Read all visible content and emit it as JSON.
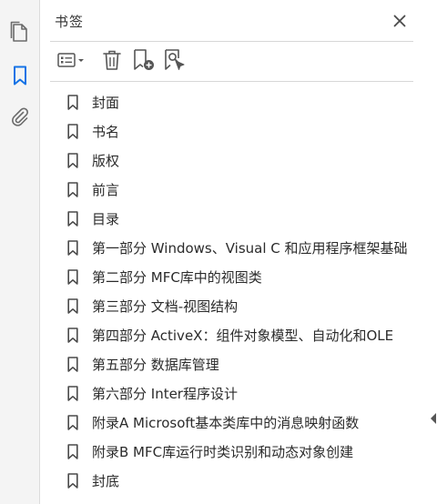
{
  "rail": {
    "items": [
      {
        "name": "pages",
        "icon": "pages-icon",
        "active": false
      },
      {
        "name": "bookmarks",
        "icon": "bookmark-icon",
        "active": true
      },
      {
        "name": "attachments",
        "icon": "paperclip-icon",
        "active": false
      }
    ],
    "accent": "#1473e6"
  },
  "panel": {
    "title": "书签",
    "close_icon": "close-icon"
  },
  "toolbar": {
    "buttons": [
      {
        "name": "options",
        "icon": "list-options-icon"
      },
      {
        "name": "delete",
        "icon": "trash-icon"
      },
      {
        "name": "new-bookmark",
        "icon": "new-bookmark-icon"
      },
      {
        "name": "find-bookmark",
        "icon": "find-bookmark-icon"
      }
    ]
  },
  "bookmarks": {
    "items": [
      {
        "label": "封面"
      },
      {
        "label": "书名"
      },
      {
        "label": "版权"
      },
      {
        "label": "前言"
      },
      {
        "label": "目录"
      },
      {
        "label": "第一部分 Windows、Visual C 和应用程序框架基础"
      },
      {
        "label": "第二部分 MFC库中的视图类"
      },
      {
        "label": "第三部分 文档-视图结构"
      },
      {
        "label": "第四部分 ActiveX：组件对象模型、自动化和OLE"
      },
      {
        "label": "第五部分 数据库管理"
      },
      {
        "label": "第六部分 Inter程序设计"
      },
      {
        "label": "附录A Microsoft基本类库中的消息映射函数"
      },
      {
        "label": "附录B MFC库运行时类识别和动态对象创建"
      },
      {
        "label": "封底"
      }
    ]
  }
}
